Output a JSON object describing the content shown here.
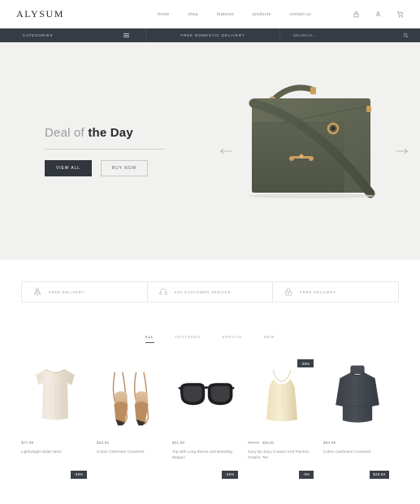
{
  "header": {
    "logo": "ALYSUM",
    "nav": [
      {
        "label": "home"
      },
      {
        "label": "shop"
      },
      {
        "label": "features"
      },
      {
        "label": "products"
      },
      {
        "label": "contact us"
      }
    ],
    "icons": [
      {
        "name": "lock-icon"
      },
      {
        "name": "user-icon"
      },
      {
        "name": "cart-icon"
      }
    ]
  },
  "category_bar": {
    "categories_label": "CATEGORIES",
    "menu_icon": "hamburger-icon",
    "promo": "FREE DOMESTIC DELIVERY",
    "search_placeholder": "SEARCH...",
    "search_icon": "search-icon"
  },
  "hero": {
    "title_light": "Deal of",
    "title_bold": "the Day",
    "buttons": [
      {
        "label": "VIEW ALL",
        "style": "dark"
      },
      {
        "label": "BUY NOW",
        "style": "outline"
      }
    ],
    "prev_icon": "arrow-left-icon",
    "next_icon": "arrow-right-icon",
    "image_alt": "olive-green-leather-shoulder-bag",
    "bag_color": "#5c6150",
    "hardware_color": "#c9a05e",
    "background": "#f1f1f0"
  },
  "features": [
    {
      "icon": "rocket-icon",
      "label": "FREE DELIVERY"
    },
    {
      "icon": "headset-icon",
      "label": "24H CUSTOMER SERVICE"
    },
    {
      "icon": "lock-icon",
      "label": "FREE DELIVERY"
    }
  ],
  "tabs": [
    {
      "label": "ALL",
      "active": true
    },
    {
      "label": "FEATURED",
      "active": false
    },
    {
      "label": "SPECIAL",
      "active": false
    },
    {
      "label": "NEW",
      "active": false
    }
  ],
  "products": [
    {
      "name": "Lightweight Italian Wool",
      "price": "$77.99",
      "old_price": "",
      "badge": "",
      "image": "beige-short-sleeve-blouse"
    },
    {
      "name": "Cotton Cashmere Crewneck",
      "price": "$33.50",
      "old_price": "",
      "badge": "",
      "image": "tan-slingback-pointed-heels"
    },
    {
      "name": "Top with Long Sleeve and Branding Badges",
      "price": "$31.50",
      "old_price": "",
      "badge": "",
      "image": "black-oversized-sunglasses"
    },
    {
      "name": "Juicy By Juicy Couture Knit Patches Graphic Tee",
      "price": "$16.40",
      "old_price": "$26.50",
      "badge": "-38%",
      "image": "cream-satin-camisole"
    },
    {
      "name": "Cotton Cashmere Crewneck",
      "price": "$50.99",
      "old_price": "",
      "badge": "",
      "image": "charcoal-turtleneck-sweater"
    }
  ],
  "products_row2": [
    {
      "badge": "-38%"
    },
    {
      "badge": ""
    },
    {
      "badge": "-38%"
    },
    {
      "badge": "-9%"
    },
    {
      "badge": "$28.60"
    }
  ],
  "colors": {
    "dark_bar": "#373c44",
    "hero_bg": "#f1f1f0",
    "badge_bg": "#3b4048",
    "text_muted": "#8d8d8d"
  }
}
